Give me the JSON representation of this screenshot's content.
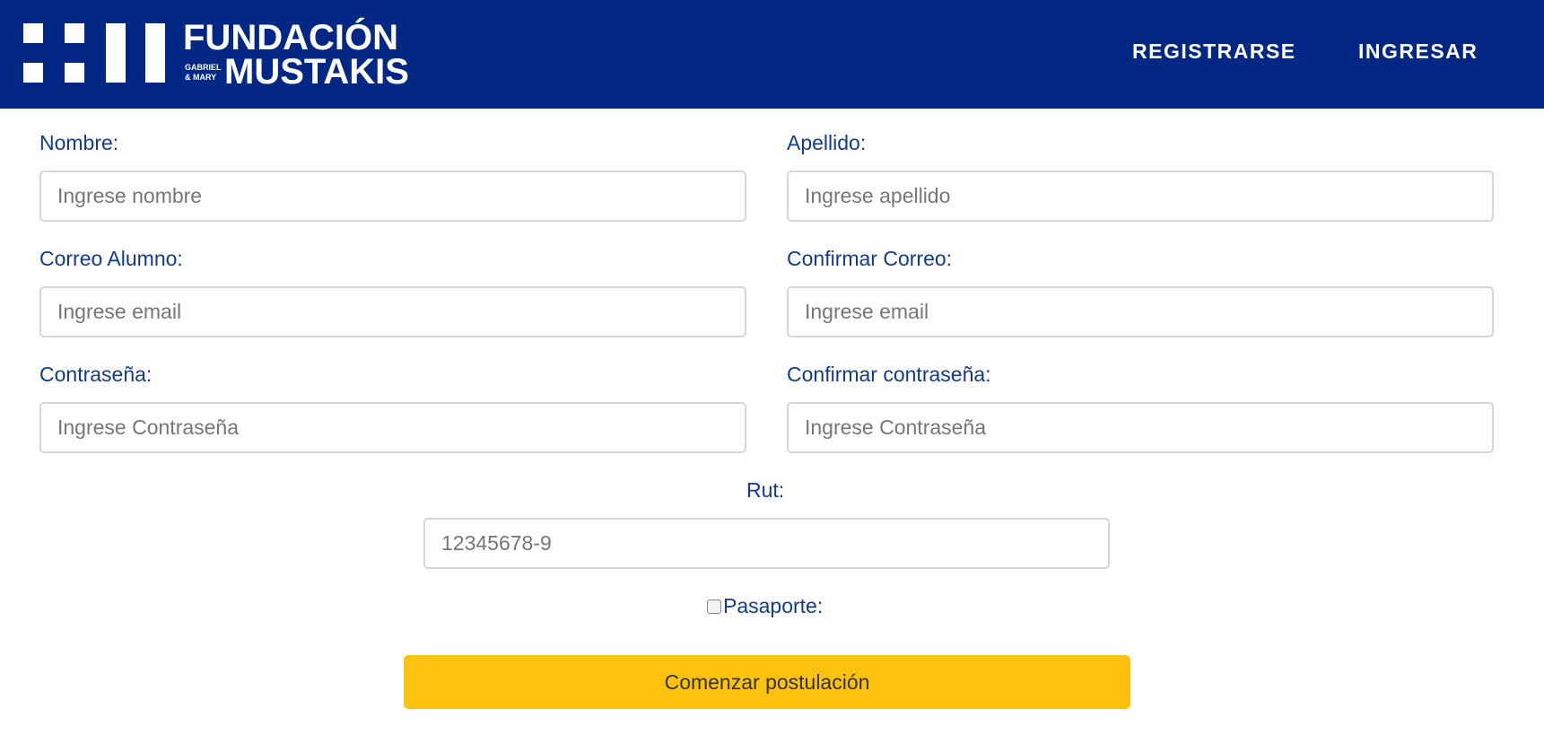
{
  "header": {
    "logo": {
      "line1": "FUNDACIÓN",
      "small_line1": "GABRIEL",
      "small_line2": "& MARY",
      "line2": "MUSTAKIS"
    },
    "nav": {
      "register": "REGISTRARSE",
      "login": "INGRESAR"
    },
    "background_color": "#022785"
  },
  "form": {
    "nombre": {
      "label": "Nombre:",
      "placeholder": "Ingrese nombre"
    },
    "apellido": {
      "label": "Apellido:",
      "placeholder": "Ingrese apellido"
    },
    "correo": {
      "label": "Correo Alumno:",
      "placeholder": "Ingrese email"
    },
    "confirmar_correo": {
      "label": "Confirmar Correo:",
      "placeholder": "Ingrese email"
    },
    "contrasena": {
      "label": "Contraseña:",
      "placeholder": "Ingrese Contraseña"
    },
    "confirmar_contrasena": {
      "label": "Confirmar contraseña:",
      "placeholder": "Ingrese Contraseña"
    },
    "rut": {
      "label": "Rut:",
      "placeholder": "12345678-9"
    },
    "pasaporte": {
      "label": "Pasaporte:",
      "checked": false
    },
    "submit_label": "Comenzar postulación",
    "label_color": "#123a8f",
    "button_color": "#fdc10f"
  }
}
